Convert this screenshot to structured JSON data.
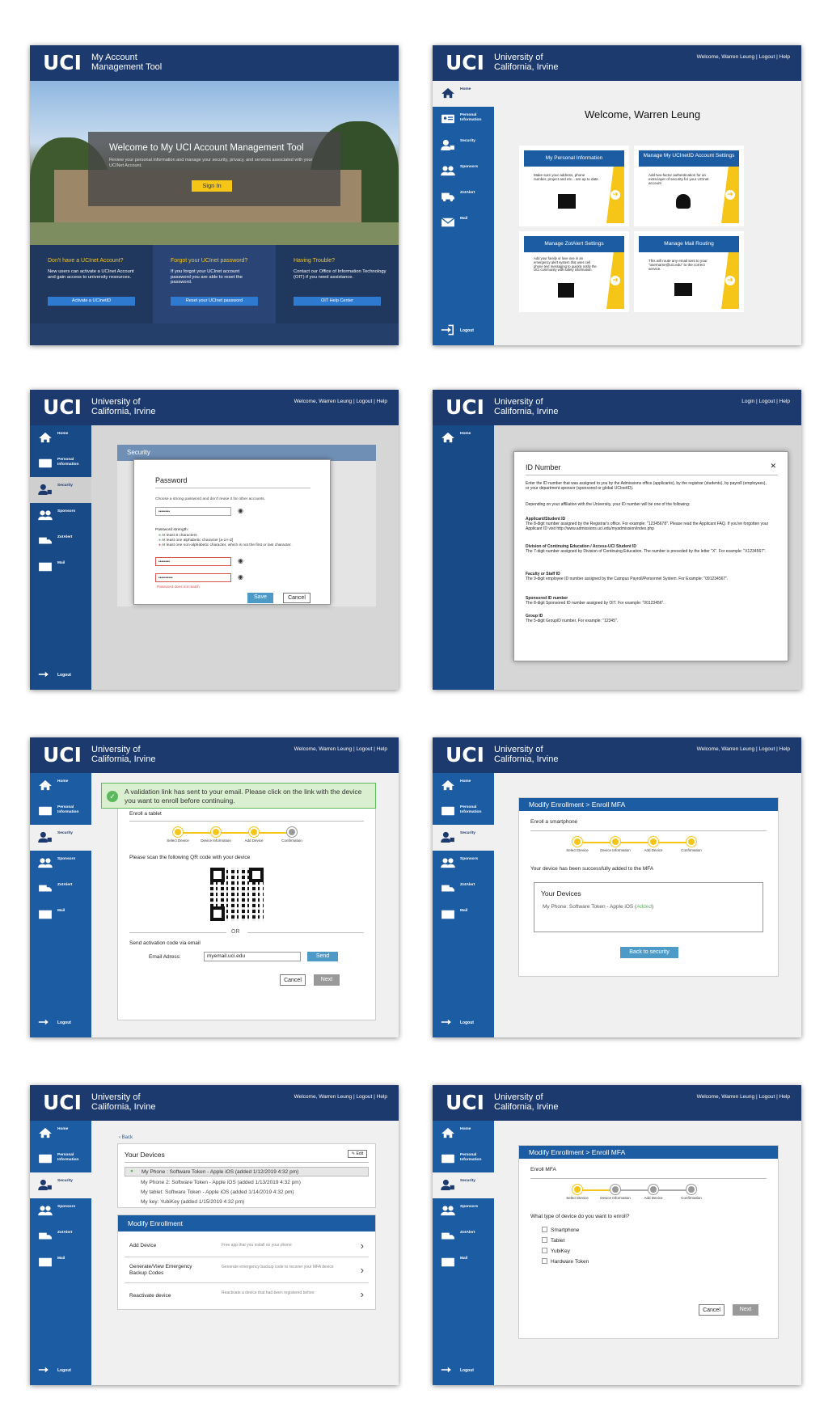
{
  "brand": {
    "logo": "UCI",
    "sub1": "University of",
    "sub2": "California, Irvine",
    "tool_sub1": "My Account",
    "tool_sub2": "Management Tool"
  },
  "header_links": {
    "welcome": "Welcome, Warren Leung | Logout | Help",
    "login": "Login | Logout | Help"
  },
  "sidebar": {
    "home": "Home",
    "personal": "Personal Information",
    "security": "Security",
    "sponsors": "Sponsors",
    "zotalert": "ZotAlert",
    "mail": "Mail",
    "logout": "Logout"
  },
  "icons": [
    "home-icon",
    "id-card-icon",
    "user-lock-icon",
    "users-icon",
    "ambulance-icon",
    "mail-icon",
    "logout-icon"
  ],
  "colors": {
    "navy": "#1c3a6e",
    "blue": "#1c5ca3",
    "yellow": "#f5c518",
    "green": "#5cb85c",
    "red": "#d9534f"
  },
  "p1": {
    "title": "Welcome to My UCI Account Management Tool",
    "desc": "Review your personal information and manage your security, privacy, and services associated with your UCINet Account.",
    "signin": "Sign In",
    "cols": [
      {
        "t": "Don't have a UCInet Account?",
        "d": "New users can activate a UCInet Account and gain access to university resources.",
        "b": "Activate a UCInetID"
      },
      {
        "t": "Forgot your UCInet password?",
        "d": "If you forgot your UCInet account password you are able to reset the password.",
        "b": "Reset your UCInet password"
      },
      {
        "t": "Having Trouble?",
        "d": "Contact our Office of Information Technology (OIT) if you need assistance.",
        "b": "OIT Help Center"
      }
    ]
  },
  "p2": {
    "welcome": "Welcome, Warren Leung",
    "tiles": [
      {
        "t": "My Personal Information",
        "d": "Make sure your address, phone number, project and etc... are up to date"
      },
      {
        "t": "Manage My UCInetID Account Settings",
        "d": "Add two-factor authentication for an extra layer of security for your UCInet account"
      },
      {
        "t": "Manage ZotAlert Settings",
        "d": "Add your family or love one in an emergency alert system that uses cell phone text messaging to quickly notify the UCI community with safety information"
      },
      {
        "t": "Manage Mail Routing",
        "d": "This will route any email sent to your \"username@uci.edu\" to the correct service."
      }
    ]
  },
  "p3": {
    "bg_title": "Security",
    "title": "Password",
    "desc": "Choose a strong password and don't reuse it for other accounts.",
    "pw1": "••••••••",
    "strength": "Password strength:",
    "r1": "At least 8 characters",
    "r2": "At least one alphabetic character [a-zA-Z]",
    "r3": "At least one non-alphabetic character, which is not the first or last character.",
    "pw2": "••••••••",
    "pw3": "••••••••••",
    "err": "Password does not match",
    "save": "Save",
    "cancel": "Cancel"
  },
  "p4": {
    "title": "ID Number",
    "close": "✕",
    "p1": "Enter the ID number that was assigned to you by the Admissions office (applicants), by the registrar (students), by payroll (employees), or your department sponsor (sponsored or global UCInetID).",
    "p2": "Depending on your affiliation with the University, your ID number will be one of the following:",
    "items": [
      {
        "h": "Applicant/Student ID",
        "d": "The 8-digit number assigned by the Registrar's office. For example: \"12345678\". Please read the Applicant FAQ. If you've forgotten your Applicant ID visit http://www.admissions.uci.edu/myadmission/index.php"
      },
      {
        "h": "Division of Continuing Education / Access-UCI Student ID",
        "d": "The 7-digit number assigned by Division of Continuing Education. The number is preceded by the letter \"X\". For example: \"X1234567\"."
      },
      {
        "h": "Faculty or Staff ID",
        "d": "The 9-digit employee ID number assigned by the Campus Payroll/Personnel System. For Example: \"091234567\"."
      },
      {
        "h": "Sponsored ID number",
        "d": "The 8-digit Sponsored ID number assigned by OIT. For example: \"00123456\"."
      },
      {
        "h": "Group ID",
        "d": "The 5-digit GroupID number. For example: \"12345\"."
      }
    ]
  },
  "steps": [
    "Select Device",
    "Device Information",
    "Add Device",
    "Confirmation"
  ],
  "p5": {
    "banner": "A validation link has sent to your email. Please click on the link with the device you want to enroll before continuing.",
    "enroll": "Enroll a tablet",
    "scan": "Please scan the following QR code with your device",
    "or": "OR",
    "send_via": "Send activation code via email",
    "email_label": "Email Adress:",
    "email_value": "myemail.uci.edu",
    "send": "Send",
    "cancel": "Cancel",
    "next": "Next"
  },
  "p6": {
    "title_a": "Modify Enrollment",
    "title_b": " > Enroll MFA",
    "enroll": "Enroll a smartphone",
    "success": "Your device has been successfully added to the MFA",
    "devices": "Your Devices",
    "device": "My Phone: Software Token - Apple iOS (",
    "added": "Added",
    "paren": ")",
    "back": "Back to security"
  },
  "p7": {
    "back": "Back",
    "devices_title": "Your Devices",
    "edit": "Edit",
    "devices": [
      "My Phone : Software Token - Apple iOS (added 1/12/2019 4:32 pm)",
      "My Phone 2: Software Token - Apple iOS (added 1/13/2019 4:32 pm)",
      "My tablet: Software Token - Apple iOS (added 1/14/2019 4:32 pm)",
      "My key: YubiKey (added 1/15/2019 4:32 pm)"
    ],
    "modify": "Modify Enrollment",
    "rows": [
      {
        "t": "Add Device",
        "d": "Free app that you install on your phone"
      },
      {
        "t": "Generate/View Emergency Backup Codes",
        "d": "Generate emergency backup code to recover your MFA device"
      },
      {
        "t": "Reactivate device",
        "d": "Reactivate a device that had been registered before"
      }
    ]
  },
  "p8": {
    "title_a": "Modify Enrollment",
    "title_b": " > Enroll MFA",
    "enroll": "Enroll MFA",
    "question": "What type of device do you want to enroll?",
    "options": [
      "Smartphone",
      "Tablet",
      "YubiKey",
      "Hardware Token"
    ],
    "cancel": "Cancel",
    "next": "Next"
  }
}
